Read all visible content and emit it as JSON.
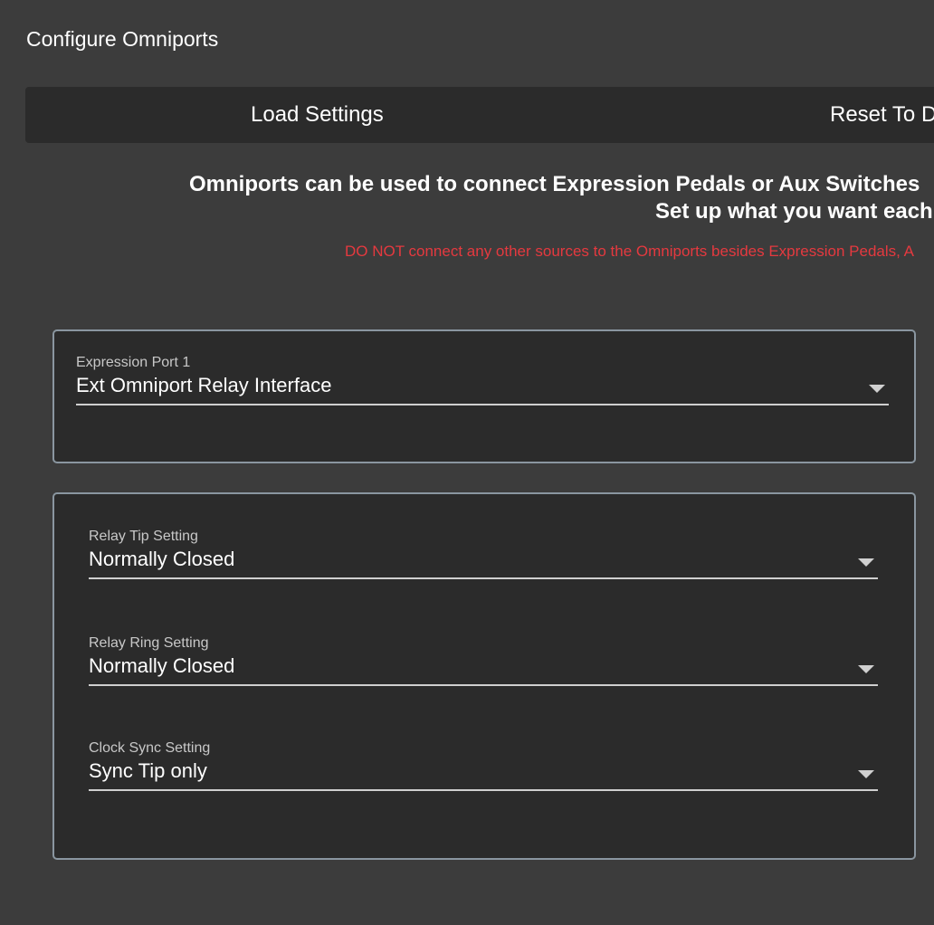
{
  "page": {
    "title": "Configure Omniports"
  },
  "toolbar": {
    "load_label": "Load Settings",
    "reset_label": "Reset To D"
  },
  "info": {
    "line1": "Omniports can be used to connect Expression Pedals or Aux Switches",
    "line2": "Set up what you want each",
    "warning": "DO NOT connect any other sources to the Omniports besides Expression Pedals, A"
  },
  "port_card": {
    "label": "Expression Port 1",
    "value": "Ext Omniport Relay Interface"
  },
  "relay_card": {
    "tip": {
      "label": "Relay Tip Setting",
      "value": "Normally Closed"
    },
    "ring": {
      "label": "Relay Ring Setting",
      "value": "Normally Closed"
    },
    "clock": {
      "label": "Clock Sync Setting",
      "value": "Sync Tip only"
    }
  },
  "icons": {
    "dropdown": "chevron-down-icon"
  },
  "colors": {
    "background": "#3c3c3c",
    "panel": "#2b2b2b",
    "card_border": "#8a96a0",
    "warning": "#e5393f",
    "text": "#ffffff"
  }
}
